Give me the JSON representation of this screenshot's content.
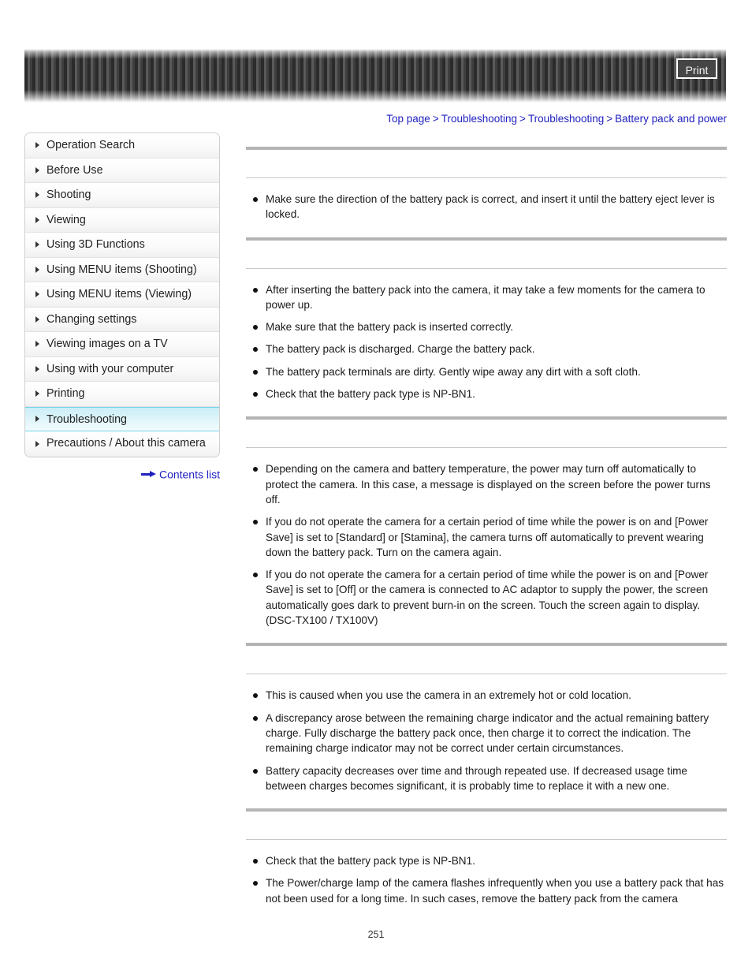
{
  "header": {
    "print_label": "Print"
  },
  "breadcrumb": {
    "items": [
      "Top page",
      "Troubleshooting",
      "Troubleshooting",
      "Battery pack and power"
    ],
    "separator": ">"
  },
  "sidebar": {
    "items": [
      {
        "label": "Operation Search",
        "selected": false
      },
      {
        "label": "Before Use",
        "selected": false
      },
      {
        "label": "Shooting",
        "selected": false
      },
      {
        "label": "Viewing",
        "selected": false
      },
      {
        "label": "Using 3D Functions",
        "selected": false
      },
      {
        "label": "Using MENU items (Shooting)",
        "selected": false
      },
      {
        "label": "Using MENU items (Viewing)",
        "selected": false
      },
      {
        "label": "Changing settings",
        "selected": false
      },
      {
        "label": "Viewing images on a TV",
        "selected": false
      },
      {
        "label": "Using with your computer",
        "selected": false
      },
      {
        "label": "Printing",
        "selected": false
      },
      {
        "label": "Troubleshooting",
        "selected": true
      },
      {
        "label": "Precautions / About this camera",
        "selected": false
      }
    ],
    "contents_list_label": "Contents list"
  },
  "content": {
    "sections": [
      {
        "heading": "",
        "bullets": [
          "Make sure the direction of the battery pack is correct, and insert it until the battery eject lever is locked."
        ]
      },
      {
        "heading": "",
        "bullets": [
          "After inserting the battery pack into the camera, it may take a few moments for the camera to power up.",
          "Make sure that the battery pack is inserted correctly.",
          "The battery pack is discharged. Charge the battery pack.",
          "The battery pack terminals are dirty. Gently wipe away any dirt with a soft cloth.",
          "Check that the battery pack type is NP-BN1."
        ]
      },
      {
        "heading": "",
        "bullets": [
          "Depending on the camera and battery temperature, the power may turn off automatically to protect the camera. In this case, a message is displayed on the screen before the power turns off.",
          "If you do not operate the camera for a certain period of time while the power is on and [Power Save] is set to [Standard] or [Stamina], the camera turns off automatically to prevent wearing down the battery pack. Turn on the camera again.",
          "If you do not operate the camera for a certain period of time while the power is on and [Power Save] is set to [Off] or the camera is connected to AC adaptor to supply the power, the screen automatically goes dark to prevent burn-in on the screen. Touch the screen again to display. (DSC-TX100 / TX100V)"
        ]
      },
      {
        "heading": "",
        "bullets": [
          "This is caused when you use the camera in an extremely hot or cold location.",
          "A discrepancy arose between the remaining charge indicator and the actual remaining battery charge. Fully discharge the battery pack once, then charge it to correct the indication. The remaining charge indicator may not be correct under certain circumstances.",
          "Battery capacity decreases over time and through repeated use. If decreased usage time between charges becomes significant, it is probably time to replace it with a new one."
        ]
      },
      {
        "heading": "",
        "bullets": [
          "Check that the battery pack type is NP-BN1.",
          "The Power/charge lamp of the camera flashes infrequently when you use a battery pack that has not been used for a long time. In such cases, remove the battery pack from the camera"
        ]
      }
    ]
  },
  "footer": {
    "page_number": "251"
  }
}
